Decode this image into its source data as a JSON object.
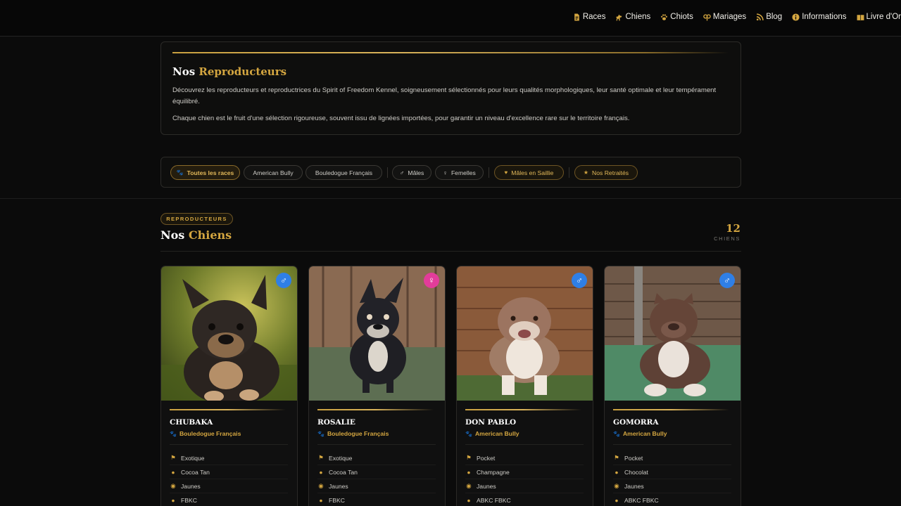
{
  "nav": {
    "items": [
      {
        "label": "Races",
        "icon": "document-icon"
      },
      {
        "label": "Chiens",
        "icon": "dog-icon"
      },
      {
        "label": "Chiots",
        "icon": "paw-icon"
      },
      {
        "label": "Mariages",
        "icon": "couple-icon"
      },
      {
        "label": "Blog",
        "icon": "rss-icon"
      },
      {
        "label": "Informations",
        "icon": "info-icon"
      },
      {
        "label": "Livre d'Or",
        "icon": "book-icon"
      }
    ]
  },
  "intro": {
    "title_a": "Nos",
    "title_b": "Reproducteurs",
    "p1": "Découvrez les reproducteurs et reproductrices du Spirit of Freedom Kennel, soigneusement sélectionnés pour leurs qualités morphologiques, leur santé optimale et leur tempérament équilibré.",
    "p2": "Chaque chien est le fruit d'une sélection rigoureuse, souvent issu de lignées importées, pour garantir un niveau d'excellence rare sur le territoire français."
  },
  "filters": {
    "all": "Toutes les races",
    "american_bully": "American Bully",
    "bouledogue": "Bouledogue Français",
    "males": "Mâles",
    "femelles": "Femelles",
    "saillie": "Mâles en Saillie",
    "retraites": "Nos Retraités"
  },
  "section": {
    "badge": "REPRODUCTEURS",
    "title_a": "Nos",
    "title_b": "Chiens",
    "count": "12",
    "count_label": "CHIENS"
  },
  "dogs": [
    {
      "name": "CHUBAKA",
      "breed": "Bouledogue Français",
      "sex": "♂",
      "type": "Exotique",
      "color": "Cocoa Tan",
      "eyes": "Jaunes",
      "registry": "FBKC"
    },
    {
      "name": "ROSALIE",
      "breed": "Bouledogue Français",
      "sex": "♀",
      "type": "Exotique",
      "color": "Cocoa Tan",
      "eyes": "Jaunes",
      "registry": "FBKC"
    },
    {
      "name": "DON PABLO",
      "breed": "American Bully",
      "sex": "♂",
      "type": "Pocket",
      "color": "Champagne",
      "eyes": "Jaunes",
      "registry": "ABKC FBKC"
    },
    {
      "name": "GOMORRA",
      "breed": "American Bully",
      "sex": "♂",
      "type": "Pocket",
      "color": "Chocolat",
      "eyes": "Jaunes",
      "registry": "ABKC FBKC"
    }
  ],
  "colors": {
    "gold": "#d4a640",
    "male": "#2f7fe6",
    "female": "#e23c9a",
    "background": "#0b0b0b"
  }
}
